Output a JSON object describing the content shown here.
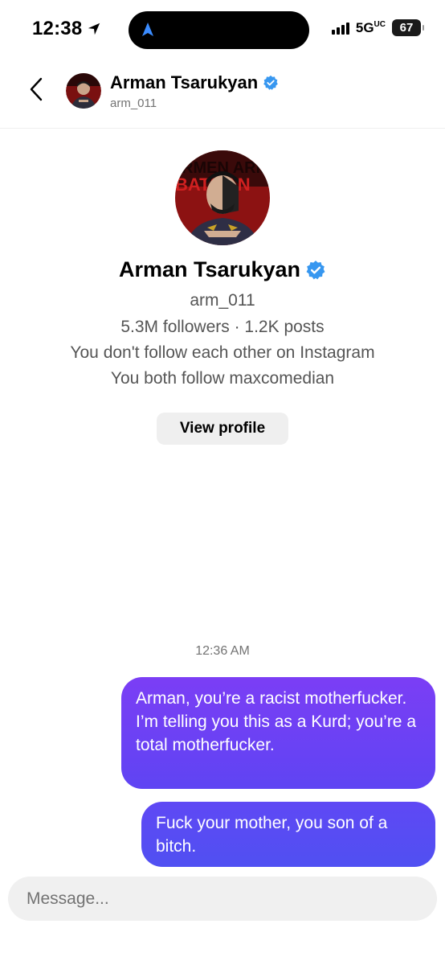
{
  "status_bar": {
    "time": "12:38",
    "network": "5G",
    "network_sup": "UC",
    "battery": "67"
  },
  "header": {
    "name": "Arman Tsarukyan",
    "handle": "arm_011"
  },
  "profile": {
    "name": "Arman Tsarukyan",
    "handle": "arm_011",
    "stats": "5.3M followers · 1.2K posts",
    "follow_status": "You don't follow each other on Instagram",
    "mutual": "You both follow maxcomedian",
    "view_profile_label": "View profile"
  },
  "conversation": {
    "timestamp": "12:36 AM",
    "messages": [
      {
        "text": "Arman, you’re a racist motherfucker. I’m telling you this as a Kurd; you’re a total motherfucker."
      },
      {
        "text": "Fuck your mother, you son of a bitch."
      }
    ]
  },
  "composer": {
    "placeholder": "Message..."
  },
  "colors": {
    "verified": "#3797f0",
    "bubble_top": "#7b3ef5",
    "bubble_bottom": "#5050f2"
  },
  "icons": [
    "location-arrow-icon",
    "navigation-icon",
    "signal-icon",
    "battery-icon",
    "back-chevron-icon",
    "verified-badge-icon"
  ]
}
